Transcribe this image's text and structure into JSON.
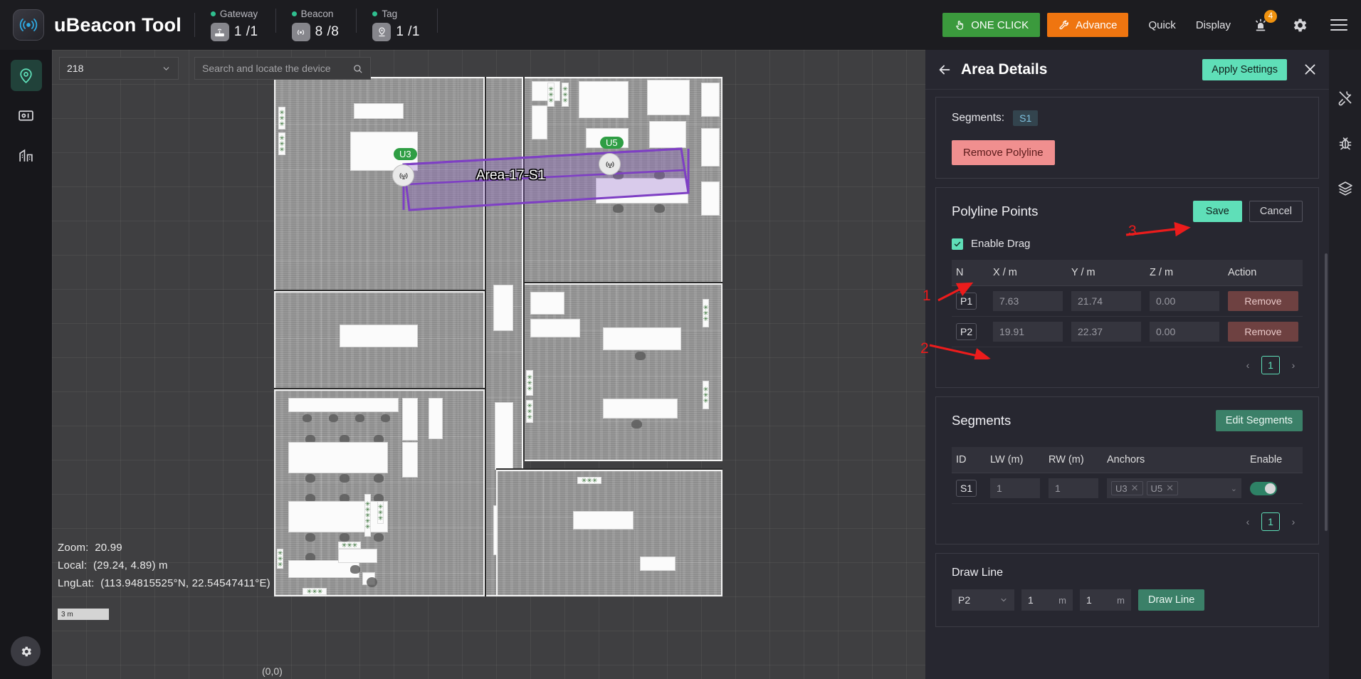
{
  "header": {
    "brand": "uBeacon Tool",
    "logo_icon": "beacon-signal-icon",
    "stats": [
      {
        "title": "Gateway",
        "icon": "router-icon",
        "value": "1 /1"
      },
      {
        "title": "Beacon",
        "icon": "beacon-icon",
        "value": "8 /8"
      },
      {
        "title": "Tag",
        "icon": "tag-pin-icon",
        "value": "1 /1"
      }
    ],
    "one_click_label": "ONE CLICK",
    "one_click_icon": "hand-click-icon",
    "one_click_color": "#3b9a3d",
    "advance_label": "Advance",
    "advance_icon": "wrench-icon",
    "advance_color": "#ef7510",
    "quick_label": "Quick",
    "display_label": "Display",
    "alarm_icon": "alarm-light-icon",
    "alarm_badge": "4",
    "alarm_badge_color": "#f0920f",
    "settings_icon": "gear-icon",
    "menu_icon": "hamburger-menu-icon"
  },
  "left_rail": {
    "items": [
      {
        "icon": "location-pin-icon",
        "active": true
      },
      {
        "icon": "device-panel-icon",
        "active": false
      },
      {
        "icon": "building-icon",
        "active": false
      }
    ],
    "gear_icon": "gear-icon"
  },
  "map": {
    "floor_select_value": "218",
    "search_placeholder": "Search and locate the device",
    "search_value": "",
    "search_icon": "search-icon",
    "caret_icon": "chevron-down-icon",
    "info": {
      "zoom_label": "Zoom:",
      "zoom_value": "20.99",
      "local_label": "Local:",
      "local_value": "(29.24,  4.89)  m",
      "lnglat_label": "LngLat:",
      "lnglat_value": "(113.94815525°N,  22.54547411°E)"
    },
    "scale_label": "3 m",
    "origin_label": "(0,0)",
    "area_label": "Area-17-S1",
    "anchors": [
      {
        "id": "U3",
        "icon": "beacon-anchor-icon"
      },
      {
        "id": "U5",
        "icon": "beacon-anchor-icon"
      }
    ],
    "polyline_color": "#7e3fc4"
  },
  "panel": {
    "back_icon": "arrow-left-icon",
    "title": "Area Details",
    "apply_label": "Apply Settings",
    "apply_color": "#5fdfb8",
    "close_icon": "close-icon",
    "segments_summary": {
      "label": "Segments:",
      "chips": [
        "S1"
      ],
      "remove_polyline_label": "Remove Polyline",
      "remove_polyline_color": "#f08f8f"
    },
    "polyline": {
      "title": "Polyline Points",
      "save_label": "Save",
      "cancel_label": "Cancel",
      "enable_drag_label": "Enable Drag",
      "enable_drag_checked": true,
      "columns": [
        "N",
        "X / m",
        "Y / m",
        "Z / m",
        "Action"
      ],
      "rows": [
        {
          "n": "P1",
          "x": "7.63",
          "y": "21.74",
          "z": "0.00",
          "action": "Remove"
        },
        {
          "n": "P2",
          "x": "19.91",
          "y": "22.37",
          "z": "0.00",
          "action": "Remove"
        }
      ],
      "page": "1",
      "prev_icon": "chevron-left-icon",
      "next_icon": "chevron-right-icon"
    },
    "segments": {
      "title": "Segments",
      "edit_label": "Edit Segments",
      "columns": [
        "ID",
        "LW (m)",
        "RW (m)",
        "Anchors",
        "Enable"
      ],
      "rows": [
        {
          "id": "S1",
          "lw": "1",
          "rw": "1",
          "anchors": [
            "U3",
            "U5"
          ],
          "enabled": true
        }
      ],
      "page": "1",
      "prev_icon": "chevron-left-icon",
      "next_icon": "chevron-right-icon"
    },
    "draw_line": {
      "title": "Draw Line",
      "point_value": "P2",
      "len1_value": "1",
      "len1_unit": "m",
      "len2_value": "1",
      "len2_unit": "m",
      "button_label": "Draw Line"
    }
  },
  "right_rail": {
    "items": [
      {
        "icon": "tools-icon"
      },
      {
        "icon": "bug-icon"
      },
      {
        "icon": "layers-icon"
      }
    ]
  },
  "annotations": [
    {
      "number": "1",
      "target": "enable-drag-checkbox"
    },
    {
      "number": "2",
      "target": "polyline-row-p1"
    },
    {
      "number": "3",
      "target": "polyline-save-button"
    }
  ]
}
